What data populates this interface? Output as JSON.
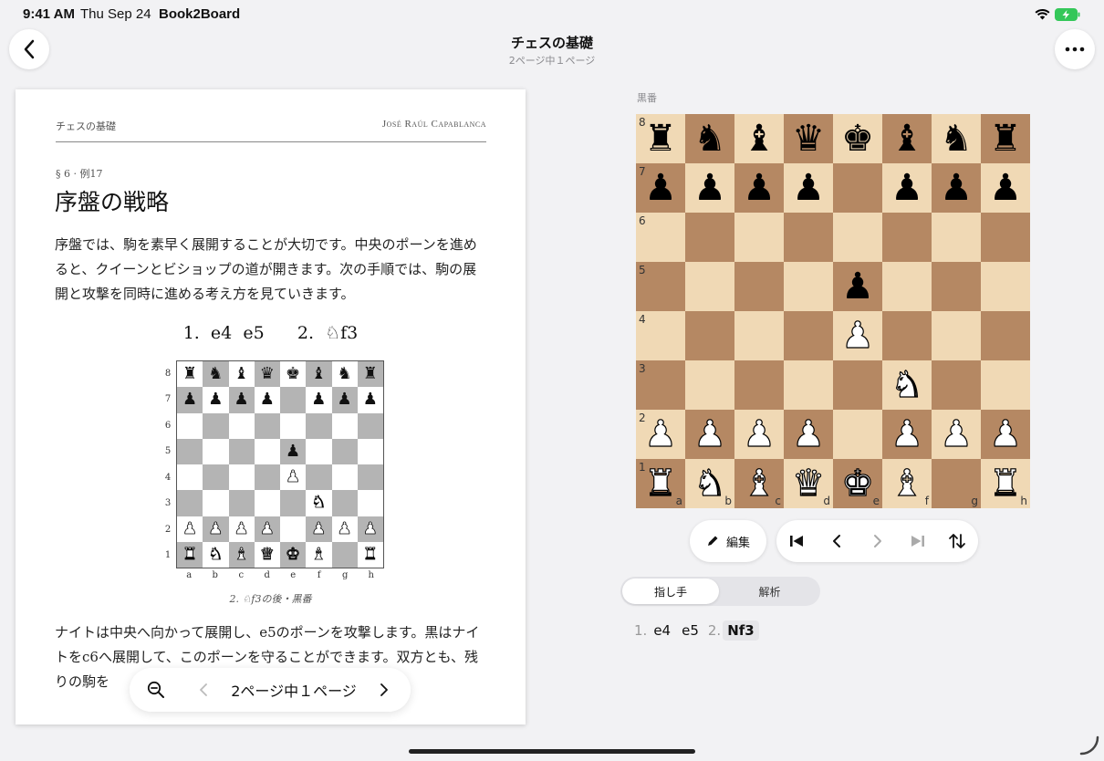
{
  "status": {
    "time": "9:41 AM",
    "date": "Thu Sep 24",
    "app": "Book2Board"
  },
  "nav": {
    "title": "チェスの基礎",
    "subtitle": "2ページ中１ページ"
  },
  "book": {
    "header_left": "チェスの基礎",
    "header_right": "José Raúl Capablanca",
    "section": "§ 6 · 例17",
    "heading": "序盤の戦略",
    "para1": "序盤では、駒を素早く展開することが大切です。中央のポーンを進めると、クイーンとビショップの道が開きます。次の手順では、駒の展開と攻撃を同時に進める考え方を見ていきます。",
    "moves": "1.  e4  e5      2.  ♘f3",
    "caption": "2. ♘f3の後・黒番",
    "para2": "ナイトは中央へ向かって展開し、e5のポーンを攻撃します。黒はナイトをc6へ展開して、このポーンを守ることができます。双方とも、残りの駒を",
    "ranks": [
      "8",
      "7",
      "6",
      "5",
      "4",
      "3",
      "2",
      "1"
    ],
    "files": [
      "a",
      "b",
      "c",
      "d",
      "e",
      "f",
      "g",
      "h"
    ]
  },
  "pager": {
    "label": "2ページ中１ページ"
  },
  "panel": {
    "turn": "黒番",
    "edit_label": "編集",
    "tabs": [
      "指し手",
      "解析"
    ],
    "moves": [
      {
        "num": "1.",
        "white": "e4",
        "black": "e5"
      },
      {
        "num": "2.",
        "white": "Nf3",
        "black": ""
      }
    ]
  },
  "position": [
    [
      "r",
      "n",
      "b",
      "q",
      "k",
      "b",
      "n",
      "r"
    ],
    [
      "p",
      "p",
      "p",
      "p",
      "",
      "p",
      "p",
      "p"
    ],
    [
      "",
      "",
      "",
      "",
      "",
      "",
      "",
      ""
    ],
    [
      "",
      "",
      "",
      "",
      "p",
      "",
      "",
      ""
    ],
    [
      "",
      "",
      "",
      "",
      "P",
      "",
      "",
      ""
    ],
    [
      "",
      "",
      "",
      "",
      "",
      "N",
      "",
      ""
    ],
    [
      "P",
      "P",
      "P",
      "P",
      "",
      "P",
      "P",
      "P"
    ],
    [
      "R",
      "N",
      "B",
      "Q",
      "K",
      "B",
      "",
      "R"
    ]
  ],
  "colors": {
    "board_light": "#f0d9b5",
    "board_dark": "#b58863",
    "mini_dark": "#b4b4b4",
    "battery": "#34c759"
  }
}
